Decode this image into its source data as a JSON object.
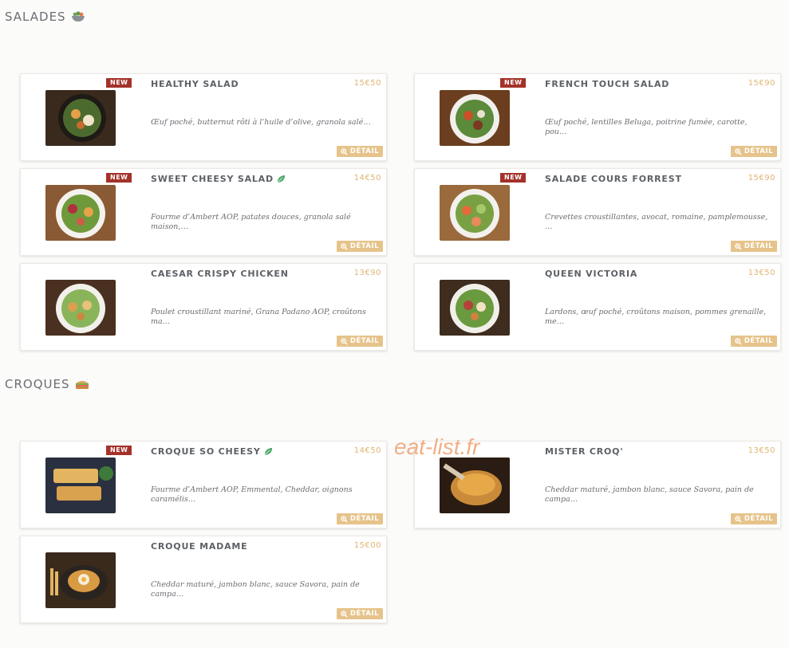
{
  "sections": [
    {
      "title": "SALADES",
      "icon": "salad-bowl-icon"
    },
    {
      "title": "CROQUES",
      "icon": "sandwich-icon"
    }
  ],
  "detail_label": "DÉTAIL",
  "new_label": "NEW",
  "items": [
    {
      "name": "HEALTHY SALAD",
      "price": "15€50",
      "desc": "Œuf poché, butternut rôti à l’huile d’olive, granola salé…"
    },
    {
      "name": "FRENCH TOUCH SALAD",
      "price": "15€90",
      "desc": "Œuf poché, lentilles Beluga, poitrine fumée, carotte, pou…"
    },
    {
      "name": "SWEET CHEESY SALAD",
      "price": "14€50",
      "desc": "Fourme d’Ambert AOP, patates douces, granola salé maison,…"
    },
    {
      "name": "SALADE COURS FORREST",
      "price": "15€90",
      "desc": "Crevettes croustillantes, avocat, romaine, pamplemousse, …"
    },
    {
      "name": "CAESAR CRISPY CHICKEN",
      "price": "13€90",
      "desc": "Poulet croustillant mariné, Grana Padano AOP, croûtons ma…"
    },
    {
      "name": "QUEEN VICTORIA",
      "price": "13€50",
      "desc": "Lardons, œuf poché, croûtons maison, pommes grenaille, me…"
    },
    {
      "name": "CROQUE SO CHEESY",
      "price": "14€50",
      "desc": "Fourme d’Ambert AOP, Emmental, Cheddar, oignons caramélis…"
    },
    {
      "name": "MISTER CROQ'",
      "price": "13€50",
      "desc": "Cheddar maturé, jambon blanc, sauce Savora, pain de campa…"
    },
    {
      "name": "CROQUE MADAME",
      "price": "15€00",
      "desc": "Cheddar maturé, jambon blanc, sauce Savora, pain de campa…"
    }
  ],
  "watermark": "eat-list.fr",
  "colors": {
    "accent": "#e6c38a",
    "price": "#e0b573",
    "badge": "#a4322a",
    "leaf": "#4aa86a"
  }
}
